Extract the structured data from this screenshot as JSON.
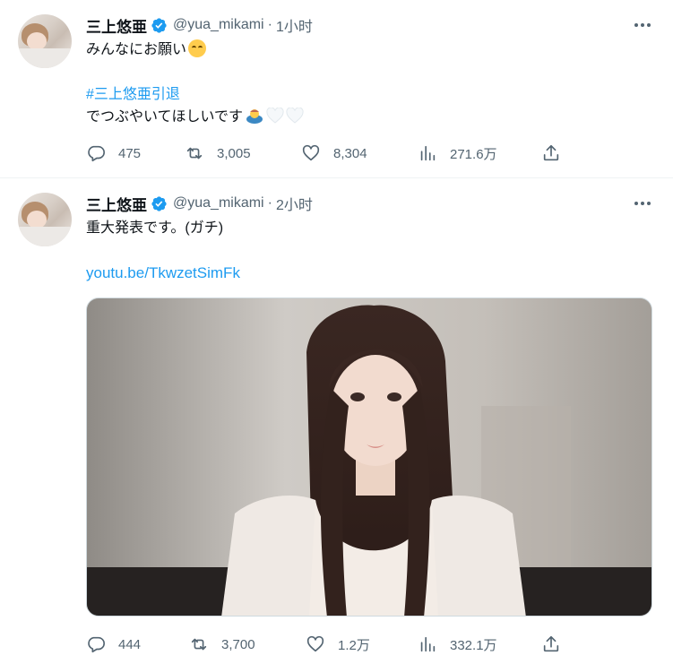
{
  "tweets": [
    {
      "name": "三上悠亜",
      "handle": "@yua_mikami",
      "separator": "·",
      "time": "1小时",
      "line1": "みんなにお願い",
      "hashtag": "#三上悠亜引退",
      "line3": "でつぶやいてほしいです",
      "actions": {
        "replies": "475",
        "retweets": "3,005",
        "likes": "8,304",
        "views": "271.6万"
      }
    },
    {
      "name": "三上悠亜",
      "handle": "@yua_mikami",
      "separator": "·",
      "time": "2小时",
      "line1": "重大発表です。(ガチ)",
      "link": "youtu.be/TkwzetSimFk",
      "actions": {
        "replies": "444",
        "retweets": "3,700",
        "likes": "1.2万",
        "views": "332.1万"
      }
    }
  ],
  "icons": {
    "verified": "verified-badge-icon",
    "more": "more-options-icon",
    "reply": "reply-icon",
    "retweet": "retweet-icon",
    "like": "like-icon",
    "views": "views-icon",
    "share": "share-icon"
  },
  "colors": {
    "link": "#1d9bf0",
    "verified": "#1d9bf0",
    "muted": "#536471",
    "text": "#0f1419"
  }
}
